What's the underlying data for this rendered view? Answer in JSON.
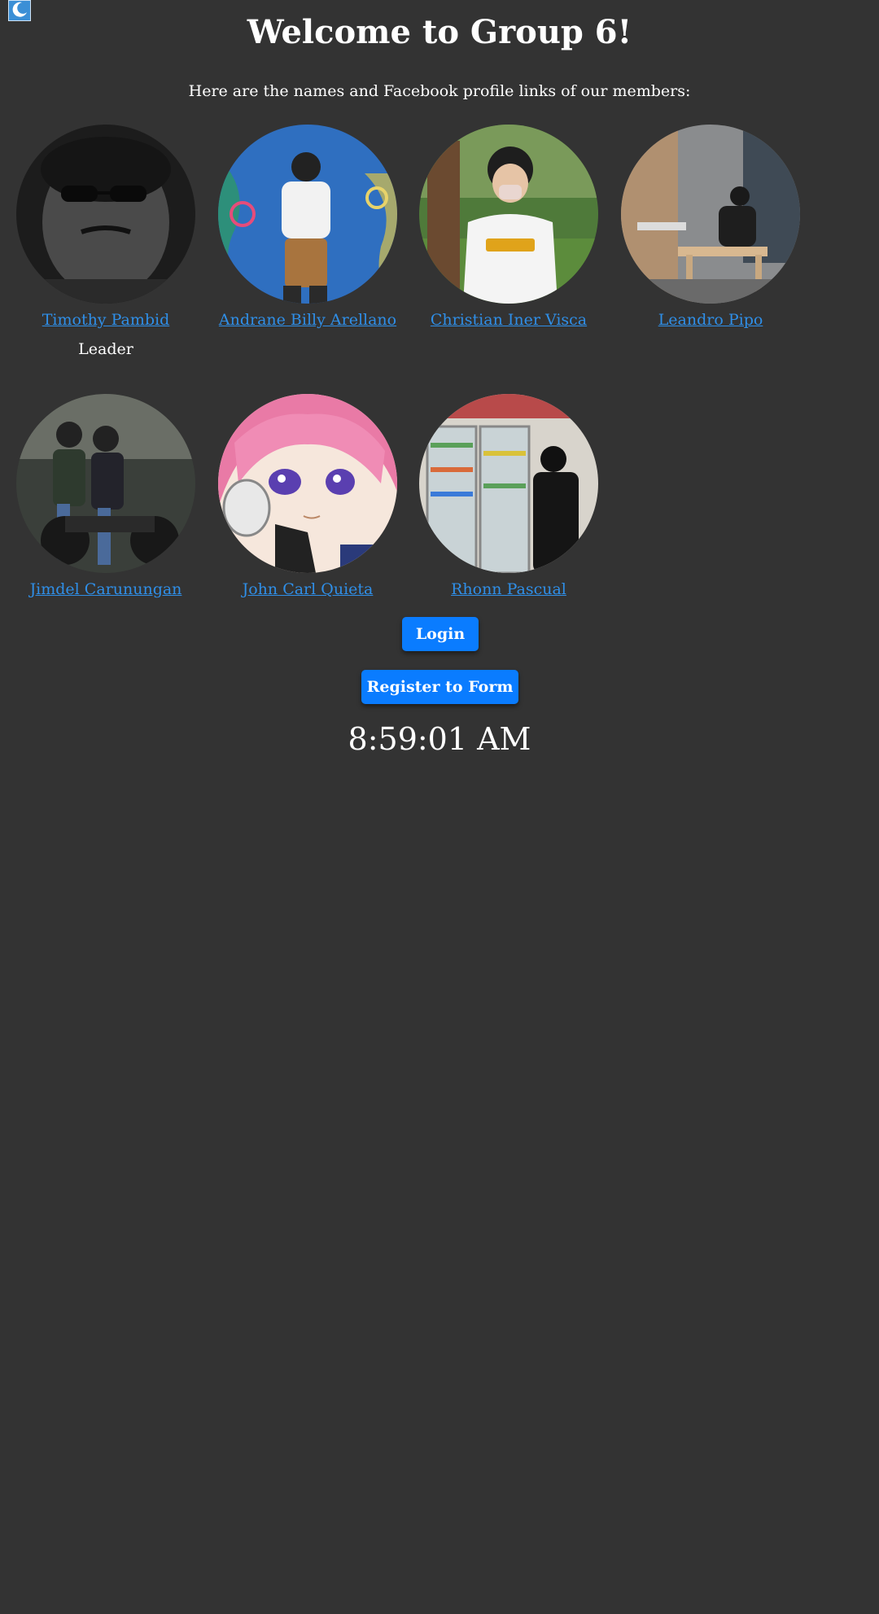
{
  "header": {
    "title": "Welcome to Group 6!",
    "intro": "Here are the names and Facebook profile links of our members:"
  },
  "theme_toggle": {
    "icon": "moon-icon",
    "color": "#3b8fd6"
  },
  "members": [
    {
      "name": "Timothy Pambid",
      "role": "Leader"
    },
    {
      "name": "Andrane Billy Arellano"
    },
    {
      "name": "Christian Iner Visca"
    },
    {
      "name": "Leandro Pipo"
    },
    {
      "name": "Jimdel Carunungan"
    },
    {
      "name": "John Carl Quieta"
    },
    {
      "name": "Rhonn Pascual"
    }
  ],
  "buttons": {
    "login": "Login",
    "register": "Register to Form"
  },
  "clock": {
    "time": "8:59:01 AM"
  },
  "colors": {
    "background": "#333333",
    "link": "#2f8fe8",
    "button": "#0a7cff"
  }
}
